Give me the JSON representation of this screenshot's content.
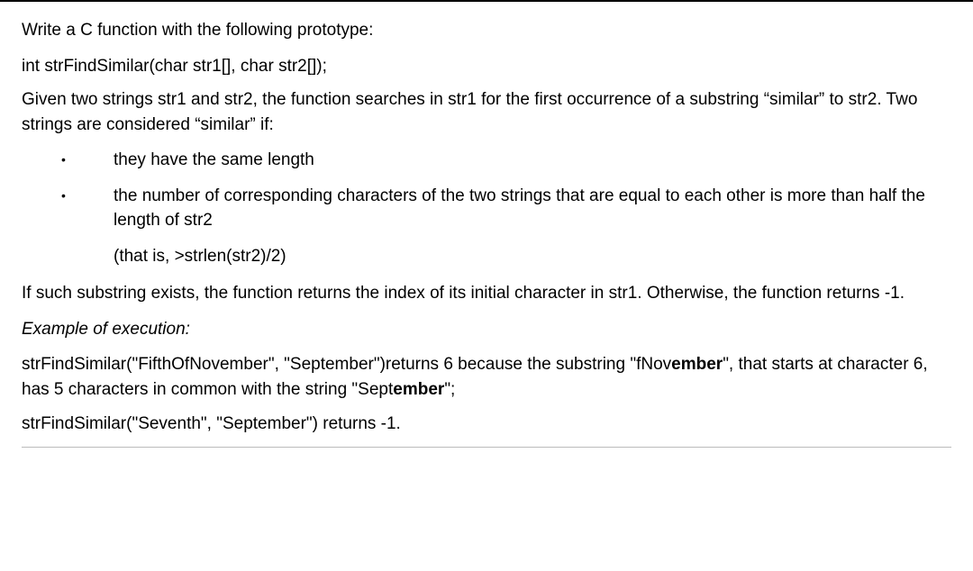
{
  "intro": "Write a C function with the following prototype:",
  "prototype": "int strFindSimilar(char str1[], char str2[]);",
  "desc": "Given two strings str1 and str2, the function searches in str1 for the first occurrence of a substring “similar” to str2. Two strings are considered “similar” if:",
  "bullets": {
    "b1": "they have the same length",
    "b2": "the number of corresponding characters of the two strings that are equal to each other is more than half the length of str2"
  },
  "sub_note": "(that is, >strlen(str2)/2)",
  "result_rule": "If such substring exists, the function returns the index of its initial character in  str1. Otherwise, the function returns -1.",
  "example_heading": "Example of execution:",
  "example1": {
    "pre1": "strFindSimilar(\"FifthOfNovember\", \"September\")returns 6 because the substring \"fNov",
    "bold1": "ember",
    "mid": "\", that starts at character 6, has 5 characters in common with the string \"Sept",
    "bold2": "ember",
    "post": "\";"
  },
  "example2": "strFindSimilar(\"Seventh\", \"September\") returns -1."
}
